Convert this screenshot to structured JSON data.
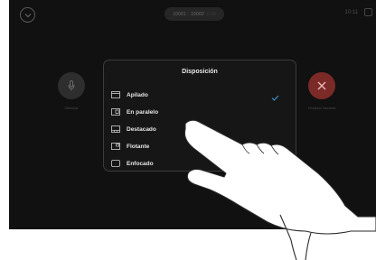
{
  "top_bar": {
    "call_numbers": "10001 : 10002",
    "call_dim": "0:00",
    "clock": "10:11"
  },
  "controls": {
    "mute_label": "Silenciar",
    "end_label": "Finalizar llamada"
  },
  "layout_menu": {
    "title": "Disposición",
    "options": [
      {
        "label": "Apilado",
        "icon": "stacked-layout-icon",
        "selected": true
      },
      {
        "label": "En paralelo",
        "icon": "side-by-side-layout-icon",
        "selected": false
      },
      {
        "label": "Destacado",
        "icon": "highlighted-layout-icon",
        "selected": false
      },
      {
        "label": "Flotante",
        "icon": "floating-layout-icon",
        "selected": false
      },
      {
        "label": "Enfocado",
        "icon": "focused-layout-icon",
        "selected": false
      }
    ]
  },
  "colors": {
    "accent": "#3a9fd8",
    "end_call": "#7b2a27"
  }
}
